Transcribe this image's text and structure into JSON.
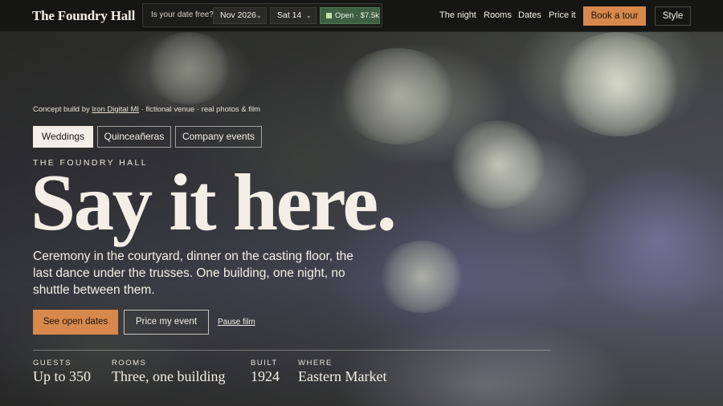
{
  "nav": {
    "brand": "The Foundry Hall",
    "date_check": {
      "question": "Is your date free?",
      "month": "Nov 2026",
      "day": "Sat 14",
      "status": "Open · $7.5k"
    },
    "links": [
      "The night",
      "Rooms",
      "Dates",
      "Price it"
    ],
    "book_tour": "Book a tour",
    "style": "Style"
  },
  "hero": {
    "credit_prefix": "Concept build by",
    "credit_link": "Iron Digital MI",
    "credit_suffix": "· fictional venue · real photos & film",
    "tabs": [
      "Weddings",
      "Quinceañeras",
      "Company events"
    ],
    "active_tab": "Weddings",
    "eyebrow": "THE FOUNDRY HALL",
    "headline": "Say it here.",
    "lede": "Ceremony in the courtyard, dinner on the casting floor, the last dance under the trusses. One building, one night, no shuttle between them.",
    "cta_primary": "See open dates",
    "cta_secondary": "Price my event",
    "pause": "Pause film"
  },
  "stats": [
    {
      "label": "GUESTS",
      "value": "Up to 350"
    },
    {
      "label": "ROOMS",
      "value": "Three, one building"
    },
    {
      "label": "BUILT",
      "value": "1924"
    },
    {
      "label": "WHERE",
      "value": "Eastern Market"
    }
  ],
  "colors": {
    "accent": "#d7894d",
    "nav_bg": "#151513",
    "open_status": "#3f5f43",
    "text": "#f4efe6"
  }
}
